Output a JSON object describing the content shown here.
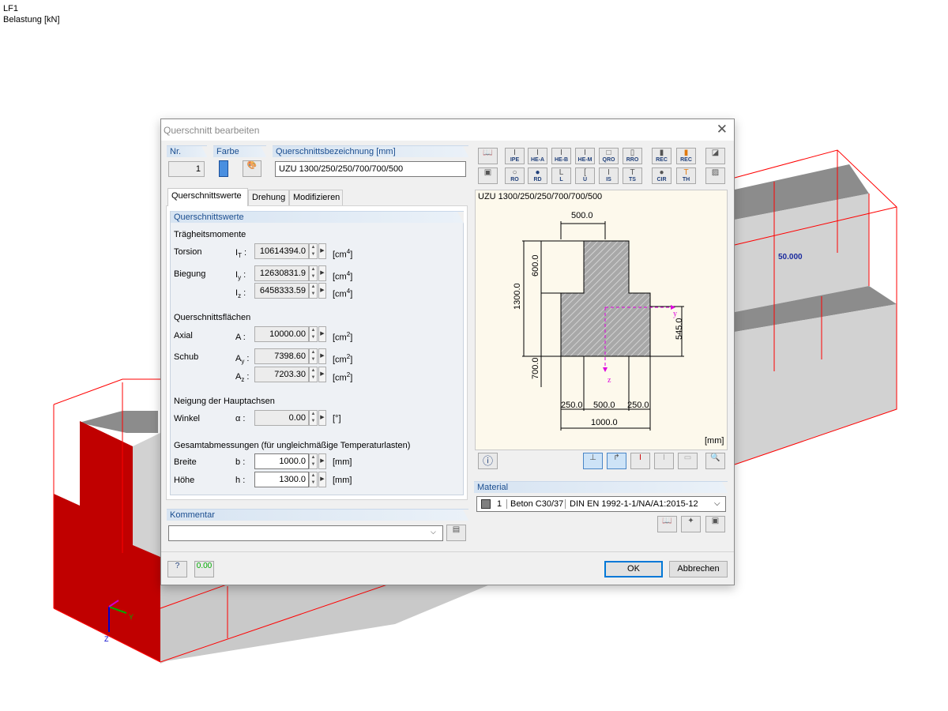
{
  "viewport": {
    "line1": "LF1",
    "line2": "Belastung [kN]",
    "load_label": "50.000",
    "axis_y": "Y",
    "axis_z": "Z"
  },
  "dialog": {
    "title": "Querschnitt bearbeiten",
    "nr": {
      "label": "Nr.",
      "value": "1"
    },
    "farbe": {
      "label": "Farbe",
      "color": "#4a8fe0"
    },
    "bezeichnung": {
      "label": "Querschnittsbezeichnung [mm]",
      "value": "UZU 1300/250/250/700/700/500"
    },
    "tabs": [
      "Querschnittswerte",
      "Drehung",
      "Modifizieren"
    ],
    "values": {
      "group_title": "Querschnittswerte",
      "inertia_heading": "Trägheitsmomente",
      "torsion_label": "Torsion",
      "it_sym": "I",
      "it_sub": "T",
      "it_value": "10614394.0",
      "biegung_label": "Biegung",
      "iy_sym": "I",
      "iy_sub": "y",
      "iy_value": "12630831.9",
      "iz_sym": "I",
      "iz_sub": "z",
      "iz_value": "6458333.59",
      "unit_cm4": "[cm",
      "sup4": "4",
      "unit_close": "]",
      "areas_heading": "Querschnittsflächen",
      "axial_label": "Axial",
      "a_sym": "A",
      "a_value": "10000.00",
      "schub_label": "Schub",
      "ay_sym": "A",
      "ay_sub": "y",
      "ay_value": "7398.60",
      "az_sym": "A",
      "az_sub": "z",
      "az_value": "7203.30",
      "unit_cm2": "[cm",
      "sup2": "2",
      "axes_heading": "Neigung der Hauptachsen",
      "winkel_label": "Winkel",
      "alpha_sym": "α",
      "alpha_value": "0.00",
      "unit_deg": "[°]",
      "dims_heading": "Gesamtabmessungen (für ungleichmäßige Temperaturlasten)",
      "breite_label": "Breite",
      "b_sym": "b",
      "b_value": "1000.0",
      "hoehe_label": "Höhe",
      "h_sym": "h",
      "h_value": "1300.0",
      "unit_mm": "[mm]",
      "colon": ":"
    },
    "library_buttons_row1": [
      "",
      "IPE",
      "HE-A",
      "HE-B",
      "HE-M",
      "QRO",
      "RRO",
      "REC",
      "REC",
      ""
    ],
    "library_buttons_row2": [
      "",
      "RO",
      "RD",
      "L",
      "U",
      "IS",
      "TS",
      "CIR",
      "TH",
      ""
    ],
    "preview": {
      "title": "UZU 1300/250/250/700/700/500",
      "unit": "[mm]",
      "dims": {
        "top": "500.0",
        "h600": "600.0",
        "h1300": "1300.0",
        "h700": "700.0",
        "h545": "545.0",
        "b250a": "250.0",
        "b500": "500.0",
        "b250b": "250.0",
        "b1000": "1000.0",
        "axis_y": "y",
        "axis_z": "z"
      }
    },
    "material": {
      "label": "Material",
      "nr": "1",
      "name": "Beton C30/37",
      "norm": "DIN EN 1992-1-1/NA/A1:2015-12",
      "swatch": "#808080"
    },
    "kommentar": {
      "label": "Kommentar",
      "value": ""
    },
    "buttons": {
      "ok": "OK",
      "cancel": "Abbrechen"
    },
    "colors": {
      "accent": "#1a4d8f",
      "section_fill": "#a0a0a0",
      "red_face": "#c00000"
    }
  }
}
